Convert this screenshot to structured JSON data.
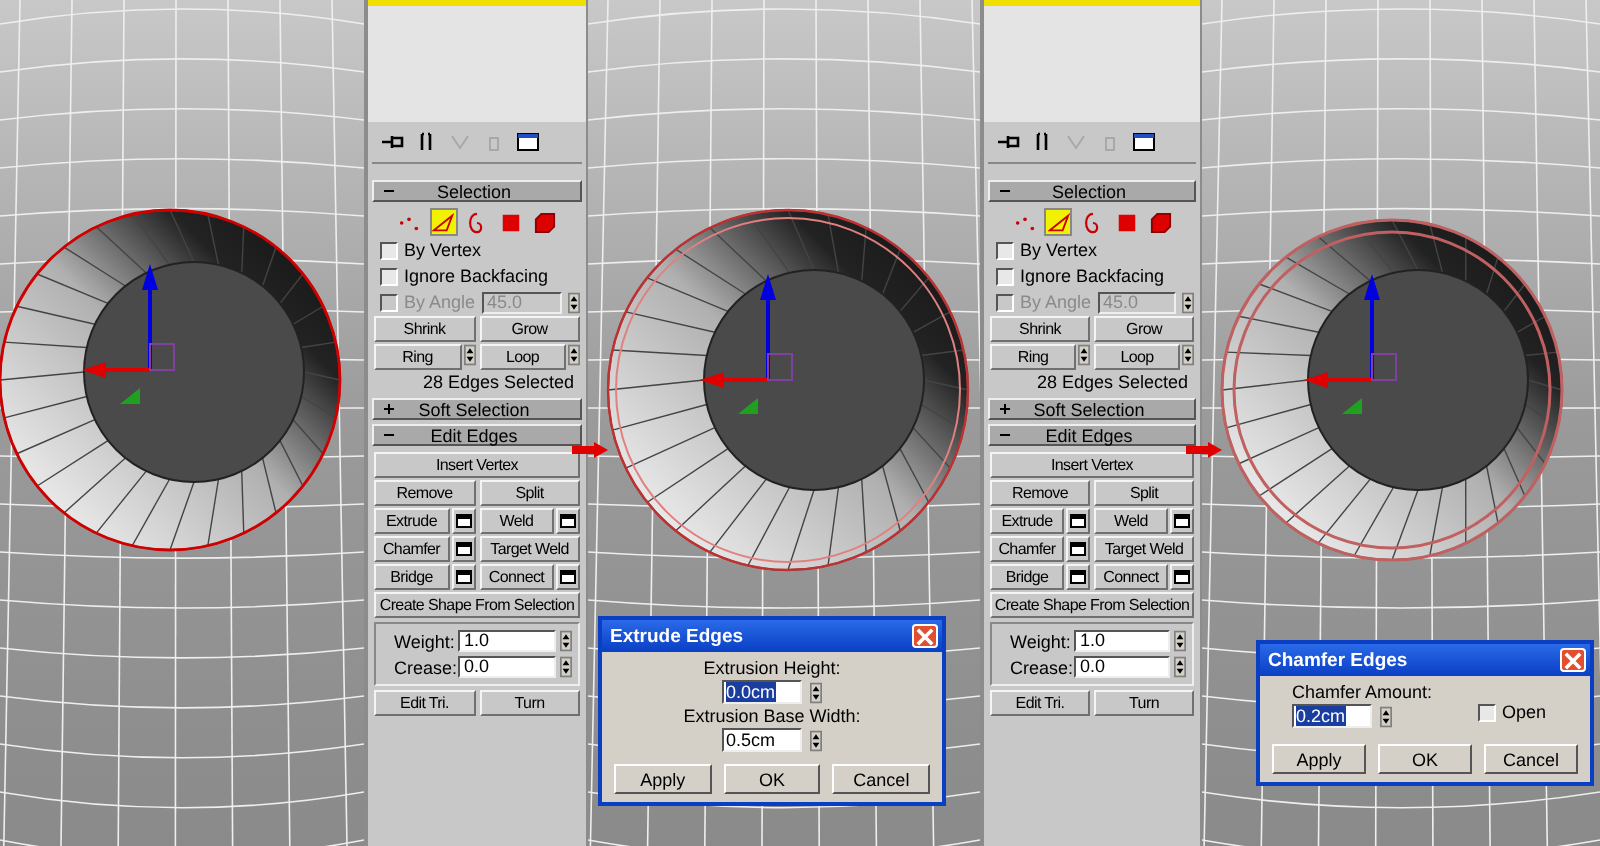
{
  "columns": [
    {
      "kind": "viewport"
    },
    {
      "kind": "panel",
      "rollouts": [
        {
          "title": "Selection",
          "expanded": true,
          "modes": [
            {
              "kind": "vertex",
              "selected": false
            },
            {
              "kind": "edge",
              "selected": true
            },
            {
              "kind": "border",
              "selected": false
            },
            {
              "kind": "polygon",
              "selected": false
            },
            {
              "kind": "element",
              "selected": false
            }
          ],
          "options": [
            {
              "label": "By Vertex",
              "checked": false,
              "disabled": false
            },
            {
              "label": "Ignore Backfacing",
              "checked": false,
              "disabled": false
            },
            {
              "label": "By Angle",
              "checked": false,
              "disabled": true,
              "value": "45.0"
            }
          ],
          "rows": [
            [
              {
                "label": "Shrink",
                "kind": "plain"
              },
              {
                "label": "Grow",
                "kind": "plain"
              }
            ],
            [
              {
                "label": "Ring",
                "kind": "spinner"
              },
              {
                "label": "Loop",
                "kind": "spinner"
              }
            ]
          ],
          "status": "28 Edges Selected"
        },
        {
          "title": "Soft Selection",
          "expanded": false
        },
        {
          "title": "Edit Edges",
          "expanded": true,
          "rows": [
            [
              {
                "label": "Insert Vertex",
                "kind": "plain"
              }
            ],
            [
              {
                "label": "Remove",
                "kind": "plain"
              },
              {
                "label": "Split",
                "kind": "plain"
              }
            ],
            [
              {
                "label": "Extrude",
                "kind": "settings"
              },
              {
                "label": "Weld",
                "kind": "settings"
              }
            ],
            [
              {
                "label": "Chamfer",
                "kind": "settings"
              },
              {
                "label": "Target Weld",
                "kind": "plain"
              }
            ],
            [
              {
                "label": "Bridge",
                "kind": "settings"
              },
              {
                "label": "Connect",
                "kind": "settings"
              }
            ],
            [
              {
                "label": "Create Shape From Selection",
                "kind": "plain"
              }
            ]
          ],
          "spinners": [
            {
              "label": "Weight:",
              "value": "1.0"
            },
            {
              "label": "Crease:",
              "value": "0.0"
            }
          ],
          "bottom": [
            {
              "label": "Edit Tri.",
              "kind": "plain"
            },
            {
              "label": "Turn",
              "kind": "plain"
            }
          ]
        }
      ]
    },
    {
      "kind": "viewport",
      "dialog": {
        "title": "Extrude Edges",
        "fields": [
          {
            "label": "Extrusion Height:",
            "value": "0.0cm",
            "selected": true
          },
          {
            "label": "Extrusion Base Width:",
            "value": "0.5cm",
            "selected": false
          }
        ],
        "buttons": [
          "Apply",
          "OK",
          "Cancel"
        ]
      }
    },
    {
      "kind": "panel",
      "rollouts": [
        {
          "title": "Selection",
          "expanded": true,
          "modes": [
            {
              "kind": "vertex",
              "selected": false
            },
            {
              "kind": "edge",
              "selected": true
            },
            {
              "kind": "border",
              "selected": false
            },
            {
              "kind": "polygon",
              "selected": false
            },
            {
              "kind": "element",
              "selected": false
            }
          ],
          "options": [
            {
              "label": "By Vertex",
              "checked": false,
              "disabled": false
            },
            {
              "label": "Ignore Backfacing",
              "checked": false,
              "disabled": false
            },
            {
              "label": "By Angle",
              "checked": false,
              "disabled": true,
              "value": "45.0"
            }
          ],
          "rows": [
            [
              {
                "label": "Shrink",
                "kind": "plain"
              },
              {
                "label": "Grow",
                "kind": "plain"
              }
            ],
            [
              {
                "label": "Ring",
                "kind": "spinner"
              },
              {
                "label": "Loop",
                "kind": "spinner"
              }
            ]
          ],
          "status": "28 Edges Selected"
        },
        {
          "title": "Soft Selection",
          "expanded": false
        },
        {
          "title": "Edit Edges",
          "expanded": true,
          "rows": [
            [
              {
                "label": "Insert Vertex",
                "kind": "plain"
              }
            ],
            [
              {
                "label": "Remove",
                "kind": "plain"
              },
              {
                "label": "Split",
                "kind": "plain"
              }
            ],
            [
              {
                "label": "Extrude",
                "kind": "settings"
              },
              {
                "label": "Weld",
                "kind": "settings"
              }
            ],
            [
              {
                "label": "Chamfer",
                "kind": "settings"
              },
              {
                "label": "Target Weld",
                "kind": "plain"
              }
            ],
            [
              {
                "label": "Bridge",
                "kind": "settings"
              },
              {
                "label": "Connect",
                "kind": "settings"
              }
            ],
            [
              {
                "label": "Create Shape From Selection",
                "kind": "plain"
              }
            ]
          ],
          "spinners": [
            {
              "label": "Weight:",
              "value": "1.0"
            },
            {
              "label": "Crease:",
              "value": "0.0"
            }
          ],
          "bottom": [
            {
              "label": "Edit Tri.",
              "kind": "plain"
            },
            {
              "label": "Turn",
              "kind": "plain"
            }
          ]
        }
      ]
    },
    {
      "kind": "viewport",
      "dialog": {
        "title": "Chamfer Edges",
        "fields": [
          {
            "label": "Chamfer Amount:",
            "value": "0.2cm",
            "selected": true
          }
        ],
        "option": {
          "label": "Open",
          "checked": false
        },
        "buttons": [
          "Apply",
          "OK",
          "Cancel"
        ]
      }
    }
  ]
}
